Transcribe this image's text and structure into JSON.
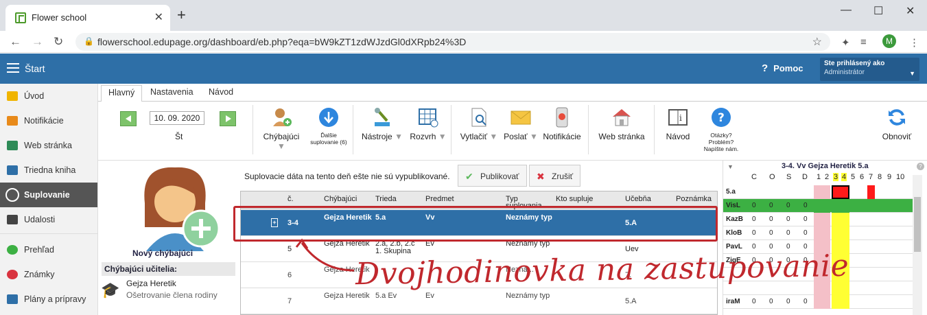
{
  "browser": {
    "tab_title": "Flower school",
    "new_tab": "+",
    "url": "flowerschool.edupage.org/dashboard/eb.php?eqa=bW9kZT1zdWJzdGl0dXRpb24%3D",
    "profile_initial": "M"
  },
  "appbar": {
    "start_label": "Štart",
    "help_label": "Pomoc",
    "login_line1": "Ste prihlásený ako",
    "login_line2": "Administrátor"
  },
  "sidebar": {
    "items": [
      {
        "label": "Úvod",
        "icon": "star-icon",
        "color": "#f0b400"
      },
      {
        "label": "Notifikácie",
        "icon": "envelope-icon",
        "color": "#e88a1a"
      },
      {
        "label": "Web stránka",
        "icon": "house-icon",
        "color": "#2e8b57"
      },
      {
        "label": "Triedna kniha",
        "icon": "book-icon",
        "color": "#2e6fa7"
      },
      {
        "label": "Suplovanie",
        "icon": "person-icon",
        "color": "#ffffff"
      },
      {
        "label": "Udalosti",
        "icon": "calendar-icon",
        "color": "#444444"
      },
      {
        "label": "Prehľad",
        "icon": "check-circle-icon",
        "color": "#3cb043"
      },
      {
        "label": "Známky",
        "icon": "grade-icon",
        "color": "#d9333f"
      },
      {
        "label": "Plány a prípravy",
        "icon": "briefcase-icon",
        "color": "#2e6fa7"
      }
    ]
  },
  "subtabs": [
    "Hlavný",
    "Nastavenia",
    "Návod"
  ],
  "toolbar": {
    "date": "10. 09. 2020",
    "day": "Št",
    "chybajuci": "Chýbajúci",
    "dalsie": "Ďalšie suplovanie (6)",
    "nastroje": "Nástroje",
    "rozvrh": "Rozvrh",
    "vytlacit": "Vytlačiť",
    "poslat": "Poslať",
    "notifikacie": "Notifikácie",
    "web": "Web stránka",
    "navod": "Návod",
    "otazky": "Otázky? Problém? Napíšte nám.",
    "obnovit": "Obnoviť"
  },
  "left": {
    "new_absent": "Nový chýbajúci",
    "absent_teachers_heading": "Chýbajúci učitelia:",
    "teacher_name": "Gejza Heretik",
    "teacher_reason": "Ošetrovanie člena rodiny"
  },
  "publish": {
    "message": "Suplovacie dáta na tento deň ešte nie sú vypublikované.",
    "publish_btn": "Publikovať",
    "cancel_btn": "Zrušiť"
  },
  "grid": {
    "headers": [
      "č.",
      "Chýbajúci",
      "Trieda",
      "Predmet",
      "Typ suplovania",
      "Kto supluje",
      "Učebňa",
      "Poznámka"
    ],
    "rows": [
      {
        "plus": "+",
        "num": "3-4",
        "absent": "Gejza Heretik",
        "class": "5.a",
        "subject": "Vv",
        "type": "Neznámy typ",
        "sub": "",
        "room": "5.A",
        "note": ""
      },
      {
        "plus": "",
        "num": "5",
        "absent": "Gejza Heretik",
        "class": "2.a, 2.b, 2.c 1. Skupina",
        "subject": "Ev",
        "type": "Neznámy typ",
        "sub": "",
        "room": "Uev",
        "note": ""
      },
      {
        "plus": "",
        "num": "6",
        "absent": "Gejza Heretik",
        "class": "",
        "subject": "",
        "type": "Nezná...",
        "sub": "",
        "room": "7.",
        "note": ""
      },
      {
        "plus": "",
        "num": "7",
        "absent": "Gejza Heretik",
        "class": "5.a Ev",
        "subject": "Ev",
        "type": "Neznámy typ",
        "sub": "",
        "room": "5.A",
        "note": ""
      }
    ]
  },
  "rightpanel": {
    "title": "3-4. Vv Gejza Heretik 5.a",
    "cols": [
      "C",
      "O",
      "S",
      "D",
      "1",
      "2",
      "3",
      "4",
      "5",
      "6",
      "7",
      "8",
      "9",
      "10"
    ],
    "rows": [
      {
        "name": "5.a",
        "vals": [
          "",
          "",
          "",
          ""
        ]
      },
      {
        "name": "VisL",
        "vals": [
          "0",
          "0",
          "0",
          "0"
        ]
      },
      {
        "name": "KazB",
        "vals": [
          "0",
          "0",
          "0",
          "0"
        ]
      },
      {
        "name": "KloB",
        "vals": [
          "0",
          "0",
          "0",
          "0"
        ]
      },
      {
        "name": "PavL",
        "vals": [
          "0",
          "0",
          "0",
          "0"
        ]
      },
      {
        "name": "ZigE",
        "vals": [
          "0",
          "0",
          "0",
          "0"
        ]
      },
      {
        "name": "",
        "vals": [
          "",
          "",
          "",
          ""
        ]
      },
      {
        "name": "",
        "vals": [
          "",
          "",
          "",
          ""
        ]
      },
      {
        "name": "iraM",
        "vals": [
          "0",
          "0",
          "0",
          "0"
        ]
      }
    ]
  },
  "annotation": {
    "text": "Dvojhodinovka na zastupovanie",
    "color": "#c0282d"
  }
}
